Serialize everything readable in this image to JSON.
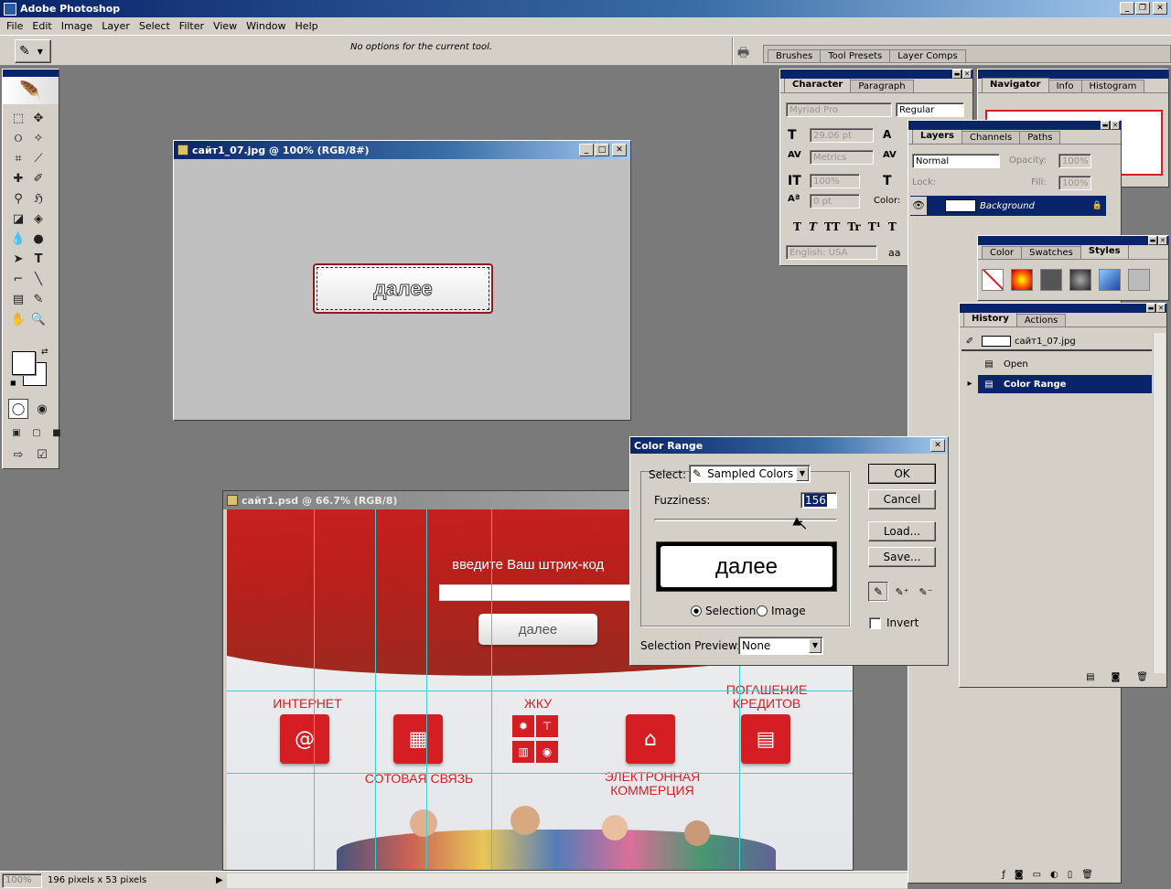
{
  "app": {
    "title": "Adobe Photoshop"
  },
  "menu": [
    "File",
    "Edit",
    "Image",
    "Layer",
    "Select",
    "Filter",
    "View",
    "Window",
    "Help"
  ],
  "options_bar": {
    "message": "No options for the current tool."
  },
  "palette_well": {
    "tabs": [
      "Brushes",
      "Tool Presets",
      "Layer Comps"
    ]
  },
  "doc1": {
    "title": "сайт1_07.jpg @ 100% (RGB/8#)",
    "button_text": "далее"
  },
  "doc2": {
    "title": "сайт1.psd @ 66.7% (RGB/8)",
    "prompt": "введите Ваш штрих-код",
    "button_text": "далее",
    "labels": {
      "internet": "ИНТЕРНЕТ",
      "zhku": "ЖКУ",
      "credits": "ПОГАШЕНИЕ\nКРЕДИТОВ",
      "mobile": "СОТОВАЯ СВЯЗЬ",
      "ecommerce": "ЭЛЕКТРОННАЯ\nКОММЕРЦИЯ"
    }
  },
  "character": {
    "tabs": [
      "Character",
      "Paragraph"
    ],
    "font": "Myriad Pro",
    "style": "Regular",
    "size": "29.06 pt",
    "kerning": "Metrics",
    "vscale": "100%",
    "tracking": "0 pt",
    "color_label": "Color:",
    "language": "English: USA",
    "style_buttons": [
      "T",
      "T",
      "TT",
      "Tr",
      "T¹",
      "T"
    ]
  },
  "navigator": {
    "tabs": [
      "Navigator",
      "Info",
      "Histogram"
    ]
  },
  "layers": {
    "tabs": [
      "Layers",
      "Channels",
      "Paths"
    ],
    "blend": "Normal",
    "opacity_label": "Opacity:",
    "opacity": "100%",
    "lock_label": "Lock:",
    "fill_label": "Fill:",
    "fill": "100%",
    "layer_name": "Background"
  },
  "color_panel": {
    "tabs": [
      "Color",
      "Swatches",
      "Styles"
    ]
  },
  "history": {
    "tabs": [
      "History",
      "Actions"
    ],
    "snapshot": "сайт1_07.jpg",
    "items": [
      "Open",
      "Color Range"
    ]
  },
  "color_range": {
    "title": "Color Range",
    "select_label": "Select:",
    "select_value": "Sampled Colors",
    "fuzziness_label": "Fuzziness:",
    "fuzziness": "156",
    "fuzziness_value": 156,
    "fuzziness_max": 200,
    "preview_text": "далее",
    "radio_selection": "Selection",
    "radio_image": "Image",
    "preview_label": "Selection Preview:",
    "preview_value": "None",
    "buttons": {
      "ok": "OK",
      "cancel": "Cancel",
      "load": "Load...",
      "save": "Save..."
    },
    "invert_label": "Invert"
  },
  "status": {
    "zoom": "100%",
    "info": "196 pixels x 53 pixels"
  }
}
